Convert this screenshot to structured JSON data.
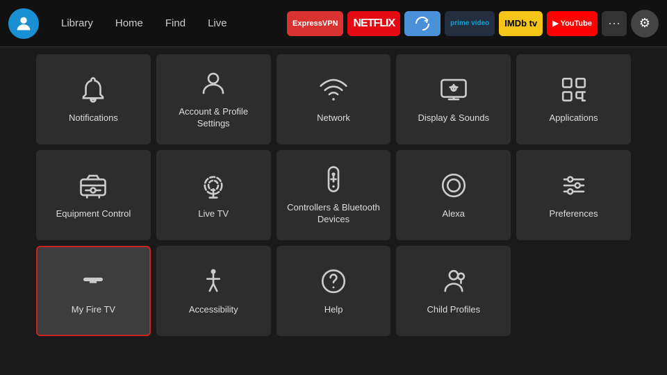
{
  "nav": {
    "links": [
      "Library",
      "Home",
      "Find",
      "Live"
    ],
    "apps": [
      {
        "label": "ExpressVPN",
        "class": "btn-expressvpn"
      },
      {
        "label": "NETFLIX",
        "class": "btn-netflix"
      },
      {
        "label": "≈",
        "class": "btn-freebird"
      },
      {
        "label": "prime video",
        "class": "btn-primevideo"
      },
      {
        "label": "IMDb tv",
        "class": "btn-imdb"
      },
      {
        "label": "▶ YouTube",
        "class": "btn-youtube"
      }
    ]
  },
  "settings": {
    "rows": [
      [
        {
          "id": "notifications",
          "label": "Notifications",
          "icon": "bell"
        },
        {
          "id": "account",
          "label": "Account & Profile Settings",
          "icon": "person"
        },
        {
          "id": "network",
          "label": "Network",
          "icon": "wifi"
        },
        {
          "id": "display",
          "label": "Display & Sounds",
          "icon": "display"
        },
        {
          "id": "applications",
          "label": "Applications",
          "icon": "apps"
        }
      ],
      [
        {
          "id": "equipment",
          "label": "Equipment Control",
          "icon": "tv"
        },
        {
          "id": "livetv",
          "label": "Live TV",
          "icon": "antenna"
        },
        {
          "id": "controllers",
          "label": "Controllers & Bluetooth Devices",
          "icon": "remote"
        },
        {
          "id": "alexa",
          "label": "Alexa",
          "icon": "alexa"
        },
        {
          "id": "preferences",
          "label": "Preferences",
          "icon": "sliders"
        }
      ],
      [
        {
          "id": "myfiretv",
          "label": "My Fire TV",
          "icon": "firetv",
          "selected": true
        },
        {
          "id": "accessibility",
          "label": "Accessibility",
          "icon": "accessibility"
        },
        {
          "id": "help",
          "label": "Help",
          "icon": "help"
        },
        {
          "id": "childprofiles",
          "label": "Child Profiles",
          "icon": "childprofiles"
        }
      ]
    ]
  }
}
